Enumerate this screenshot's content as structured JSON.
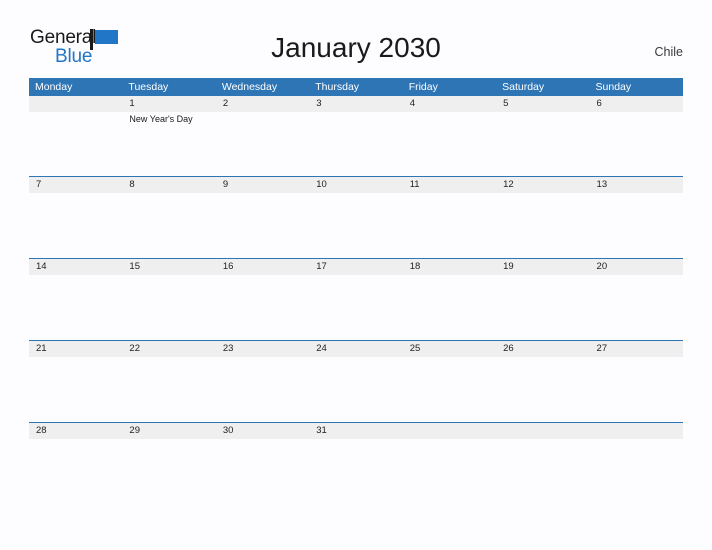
{
  "brand": {
    "word_one": "General",
    "word_two": "Blue",
    "flag_icon": "flag-triangle-icon",
    "color_blue": "#2176c7",
    "color_dark": "#1a1a1a"
  },
  "header": {
    "title": "January 2030",
    "country": "Chile"
  },
  "theme": {
    "header_blue": "#2e75b6",
    "row_border_blue": "#2e75b6",
    "date_band_gray": "#efefef",
    "page_background": "#fdfdff"
  },
  "calendar": {
    "weekdays": [
      "Monday",
      "Tuesday",
      "Wednesday",
      "Thursday",
      "Friday",
      "Saturday",
      "Sunday"
    ],
    "weeks": [
      {
        "days": [
          {
            "date": "",
            "events": []
          },
          {
            "date": "1",
            "events": [
              "New Year's Day"
            ]
          },
          {
            "date": "2",
            "events": []
          },
          {
            "date": "3",
            "events": []
          },
          {
            "date": "4",
            "events": []
          },
          {
            "date": "5",
            "events": []
          },
          {
            "date": "6",
            "events": []
          }
        ]
      },
      {
        "days": [
          {
            "date": "7",
            "events": []
          },
          {
            "date": "8",
            "events": []
          },
          {
            "date": "9",
            "events": []
          },
          {
            "date": "10",
            "events": []
          },
          {
            "date": "11",
            "events": []
          },
          {
            "date": "12",
            "events": []
          },
          {
            "date": "13",
            "events": []
          }
        ]
      },
      {
        "days": [
          {
            "date": "14",
            "events": []
          },
          {
            "date": "15",
            "events": []
          },
          {
            "date": "16",
            "events": []
          },
          {
            "date": "17",
            "events": []
          },
          {
            "date": "18",
            "events": []
          },
          {
            "date": "19",
            "events": []
          },
          {
            "date": "20",
            "events": []
          }
        ]
      },
      {
        "days": [
          {
            "date": "21",
            "events": []
          },
          {
            "date": "22",
            "events": []
          },
          {
            "date": "23",
            "events": []
          },
          {
            "date": "24",
            "events": []
          },
          {
            "date": "25",
            "events": []
          },
          {
            "date": "26",
            "events": []
          },
          {
            "date": "27",
            "events": []
          }
        ]
      },
      {
        "days": [
          {
            "date": "28",
            "events": []
          },
          {
            "date": "29",
            "events": []
          },
          {
            "date": "30",
            "events": []
          },
          {
            "date": "31",
            "events": []
          },
          {
            "date": "",
            "events": []
          },
          {
            "date": "",
            "events": []
          },
          {
            "date": "",
            "events": []
          }
        ]
      }
    ]
  }
}
